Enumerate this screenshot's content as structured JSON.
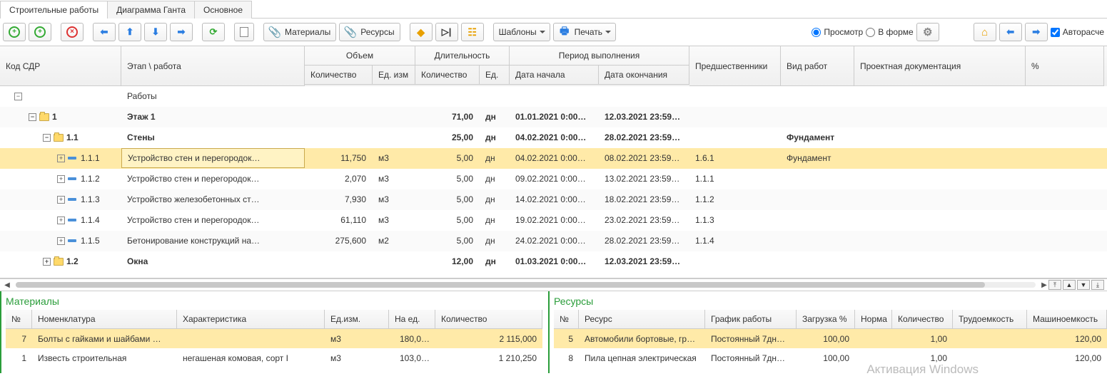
{
  "tabs": [
    "Строительные работы",
    "Диаграмма Ганта",
    "Основное"
  ],
  "toolbar": {
    "materials": "Материалы",
    "resources": "Ресурсы",
    "templates": "Шаблоны",
    "print": "Печать",
    "view_preview": "Просмотр",
    "view_form": "В форме",
    "autocalc": "Авторасче"
  },
  "columns": {
    "code": "Код СДР",
    "stage": "Этап \\ работа",
    "volume": "Объем",
    "duration": "Длительность",
    "period": "Период выполнения",
    "predecessors": "Предшественники",
    "work_type": "Вид работ",
    "docs": "Проектная документация",
    "pct": "%",
    "qty": "Количество",
    "unit": "Ед. изм",
    "unit2": "Ед.",
    "date_start": "Дата начала",
    "date_end": "Дата окончания"
  },
  "rows": [
    {
      "level": 0,
      "type": "root",
      "code": "",
      "name": "Работы",
      "bold": false,
      "exp": "-"
    },
    {
      "level": 1,
      "type": "folder",
      "code": "1",
      "name": "Этаж 1",
      "bold": true,
      "exp": "-",
      "dqty": "71,00",
      "dunit": "дн",
      "d1": "01.01.2021 0:00…",
      "d2": "12.03.2021 23:59…"
    },
    {
      "level": 2,
      "type": "folder",
      "code": "1.1",
      "name": "Стены",
      "bold": true,
      "exp": "-",
      "dqty": "25,00",
      "dunit": "дн",
      "d1": "04.02.2021 0:00…",
      "d2": "28.02.2021 23:59…",
      "wtype": "Фундамент"
    },
    {
      "level": 3,
      "type": "leaf",
      "code": "1.1.1",
      "name": "Устройство стен и перегородок…",
      "exp": "+",
      "selected": true,
      "vqty": "11,750",
      "vunit": "м3",
      "dqty": "5,00",
      "dunit": "дн",
      "d1": "04.02.2021 0:00…",
      "d2": "08.02.2021 23:59…",
      "pred": "1.6.1",
      "wtype": "Фундамент"
    },
    {
      "level": 3,
      "type": "leaf",
      "code": "1.1.2",
      "name": "Устройство стен и перегородок…",
      "exp": "+",
      "vqty": "2,070",
      "vunit": "м3",
      "dqty": "5,00",
      "dunit": "дн",
      "d1": "09.02.2021 0:00…",
      "d2": "13.02.2021 23:59…",
      "pred": "1.1.1"
    },
    {
      "level": 3,
      "type": "leaf",
      "code": "1.1.3",
      "name": "Устройство железобетонных ст…",
      "exp": "+",
      "vqty": "7,930",
      "vunit": "м3",
      "dqty": "5,00",
      "dunit": "дн",
      "d1": "14.02.2021 0:00…",
      "d2": "18.02.2021 23:59…",
      "pred": "1.1.2"
    },
    {
      "level": 3,
      "type": "leaf",
      "code": "1.1.4",
      "name": "Устройство стен и перегородок…",
      "exp": "+",
      "vqty": "61,110",
      "vunit": "м3",
      "dqty": "5,00",
      "dunit": "дн",
      "d1": "19.02.2021 0:00…",
      "d2": "23.02.2021 23:59…",
      "pred": "1.1.3"
    },
    {
      "level": 3,
      "type": "leaf",
      "code": "1.1.5",
      "name": "Бетонирование конструкций на…",
      "exp": "+",
      "vqty": "275,600",
      "vunit": "м2",
      "dqty": "5,00",
      "dunit": "дн",
      "d1": "24.02.2021 0:00…",
      "d2": "28.02.2021 23:59…",
      "pred": "1.1.4"
    },
    {
      "level": 2,
      "type": "folder",
      "code": "1.2",
      "name": "Окна",
      "bold": true,
      "exp": "+",
      "dqty": "12,00",
      "dunit": "дн",
      "d1": "01.03.2021 0:00…",
      "d2": "12.03.2021 23:59…"
    }
  ],
  "materials": {
    "title": "Материалы",
    "cols": {
      "no": "№",
      "nom": "Номенклатура",
      "char": "Характеристика",
      "unit": "Ед.изм.",
      "each": "На ед.",
      "qty": "Количество"
    },
    "rows": [
      {
        "no": "7",
        "nom": "Болты с гайками и шайбами …",
        "char": "",
        "unit": "м3",
        "each": "180,0…",
        "qty": "2 115,000",
        "sel": true
      },
      {
        "no": "1",
        "nom": "Известь строительная",
        "char": "негашеная комовая, сорт I",
        "unit": "м3",
        "each": "103,0…",
        "qty": "1 210,250"
      }
    ]
  },
  "resources": {
    "title": "Ресурсы",
    "cols": {
      "no": "№",
      "res": "Ресурс",
      "sched": "График работы",
      "load": "Загрузка %",
      "norm": "Норма",
      "qty": "Количество",
      "lab": "Трудоемкость",
      "mach": "Машиноемкость"
    },
    "rows": [
      {
        "no": "5",
        "res": "Автомобили бортовые, гр…",
        "sched": "Постоянный 7дн…",
        "load": "100,00",
        "norm": "",
        "qty": "1,00",
        "lab": "",
        "mach": "120,00",
        "sel": true
      },
      {
        "no": "8",
        "res": "Пила цепная электрическая",
        "sched": "Постоянный 7дн…",
        "load": "100,00",
        "norm": "",
        "qty": "1,00",
        "lab": "",
        "mach": "120,00"
      }
    ]
  },
  "watermark": "Активация Windows"
}
